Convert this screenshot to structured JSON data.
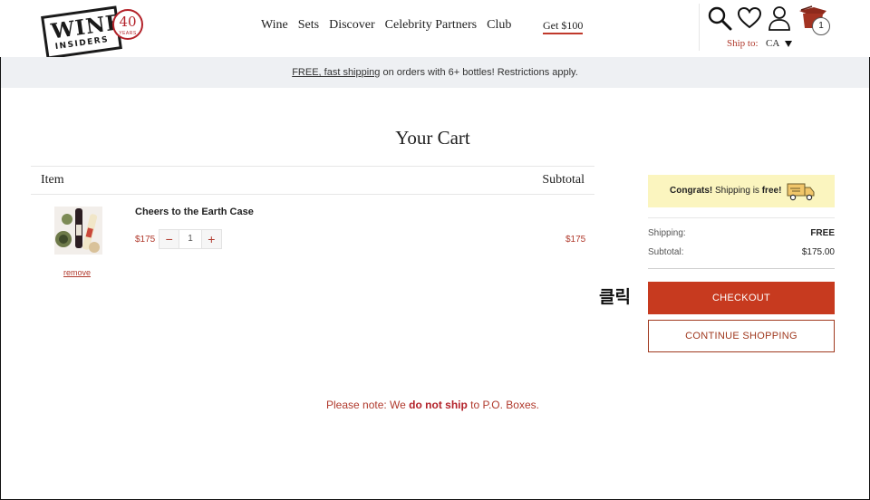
{
  "header": {
    "logo": {
      "word": "WINE",
      "sub": "INSIDERS",
      "seal_number": "40",
      "seal_text": "YEARS"
    },
    "nav": [
      "Wine",
      "Sets",
      "Discover",
      "Celebrity Partners",
      "Club"
    ],
    "promo_link": "Get $100",
    "cart_count": "1",
    "ship_to_label": "Ship to:",
    "ship_to_value": "CA",
    "icons": [
      "search-icon",
      "heart-icon",
      "user-icon",
      "cart-icon",
      "chevron-down-icon"
    ]
  },
  "banner": {
    "link_text": "FREE, fast shipping",
    "rest_text": " on orders with 6+ bottles! Restrictions apply."
  },
  "cart": {
    "title": "Your Cart",
    "col_item": "Item",
    "col_subtotal": "Subtotal",
    "items": [
      {
        "name": "Cheers to the Earth Case",
        "price": "$175",
        "quantity": "1",
        "subtotal": "$175",
        "remove_label": "remove"
      }
    ],
    "stepper": {
      "minus": "−",
      "plus": "+"
    }
  },
  "summary": {
    "congrats_strong": "Congrats!",
    "congrats_mid": " Shipping is ",
    "congrats_free": "free!",
    "shipping_label": "Shipping:",
    "shipping_value": "FREE",
    "subtotal_label": "Subtotal:",
    "subtotal_value": "$175.00",
    "checkout_label": "CHECKOUT",
    "continue_label": "CONTINUE SHOPPING"
  },
  "annotation": "클릭",
  "note": {
    "prefix": "Please note: We ",
    "strong": "do not ship",
    "suffix": " to P.O. Boxes."
  },
  "colors": {
    "accent": "#c73a1f",
    "brand_red": "#b3222a",
    "price": "#b0392c",
    "banner_bg": "#eef0f3",
    "congrats_bg": "#fbf5bf"
  }
}
